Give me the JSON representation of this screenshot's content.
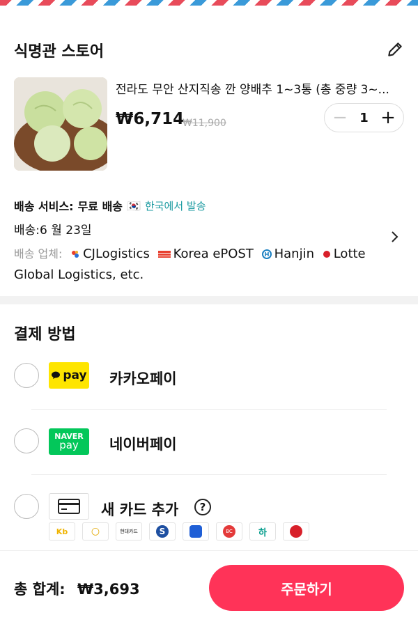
{
  "store": {
    "name": "식명관 스토어",
    "item": {
      "title": "전라도 무안 산지직송 깐 양배추 1~3통 (총 중량 3~...",
      "price": "₩6,714",
      "original_price": "₩11,900",
      "quantity": "1",
      "minus": "−",
      "plus": "+"
    }
  },
  "shipping": {
    "service_label": "배송 서비스:",
    "service_value": "무료 배송",
    "flag": "🇰🇷",
    "origin": "한국에서 발송",
    "date": "배송:6 월 23일",
    "carriers_label": "배송 업체:",
    "carriers": [
      "CJLogistics",
      "Korea ePOST",
      "Hanjin",
      "Lotte Global Logistics, etc."
    ]
  },
  "payment": {
    "title": "결제 방법",
    "options": [
      {
        "label": "카카오페이",
        "logo_text": "pay"
      },
      {
        "label": "네이버페이",
        "logo_top": "NAVER",
        "logo_bottom": "pay"
      },
      {
        "label": "새 카드 추가",
        "help": "?"
      }
    ],
    "banks": [
      "Kb",
      "○",
      "현대카드",
      "S",
      "●",
      "BC",
      "하",
      "●"
    ]
  },
  "footer": {
    "total_label": "총 합계:",
    "total_value": "₩3,693",
    "order_label": "주문하기"
  },
  "colors": {
    "accent": "#ff3358",
    "teal": "#1a9aa0",
    "kakao": "#fee500",
    "naver": "#03c75a"
  }
}
